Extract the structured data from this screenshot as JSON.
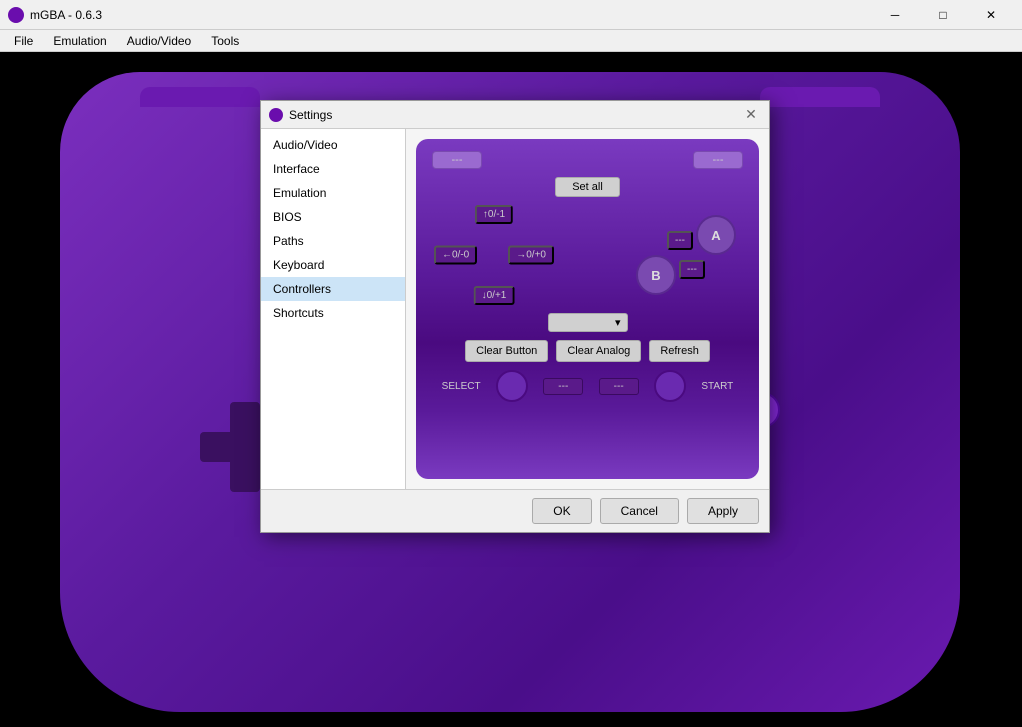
{
  "app": {
    "title": "mGBA - 0.6.3",
    "icon": "gba-icon"
  },
  "titlebar": {
    "minimize_label": "─",
    "maximize_label": "□",
    "close_label": "✕"
  },
  "menubar": {
    "items": [
      {
        "label": "File"
      },
      {
        "label": "Emulation"
      },
      {
        "label": "Audio/Video"
      },
      {
        "label": "Tools"
      }
    ]
  },
  "settings": {
    "title": "Settings",
    "nav": [
      {
        "label": "Audio/Video",
        "id": "audio-video"
      },
      {
        "label": "Interface",
        "id": "interface"
      },
      {
        "label": "Emulation",
        "id": "emulation"
      },
      {
        "label": "BIOS",
        "id": "bios"
      },
      {
        "label": "Paths",
        "id": "paths"
      },
      {
        "label": "Keyboard",
        "id": "keyboard"
      },
      {
        "label": "Controllers",
        "id": "controllers",
        "active": true
      },
      {
        "label": "Shortcuts",
        "id": "shortcuts"
      }
    ],
    "controllers": {
      "l_button": "---",
      "r_button": "---",
      "set_all": "Set all",
      "dpad_up": "↑0/-1",
      "dpad_down": "↓0/+1",
      "dpad_left": "←0/-0",
      "dpad_right": "→0/+0",
      "btn_a_label": "A",
      "btn_b_label": "B",
      "a_mapping": "---",
      "b_mapping": "---",
      "dropdown_arrow": "▾",
      "clear_button": "Clear Button",
      "clear_analog": "Clear Analog",
      "refresh": "Refresh",
      "select_label": "SELECT",
      "start_label": "START",
      "select_mapping": "---",
      "start_mapping": "---"
    },
    "footer": {
      "ok": "OK",
      "cancel": "Cancel",
      "apply": "Apply"
    }
  }
}
